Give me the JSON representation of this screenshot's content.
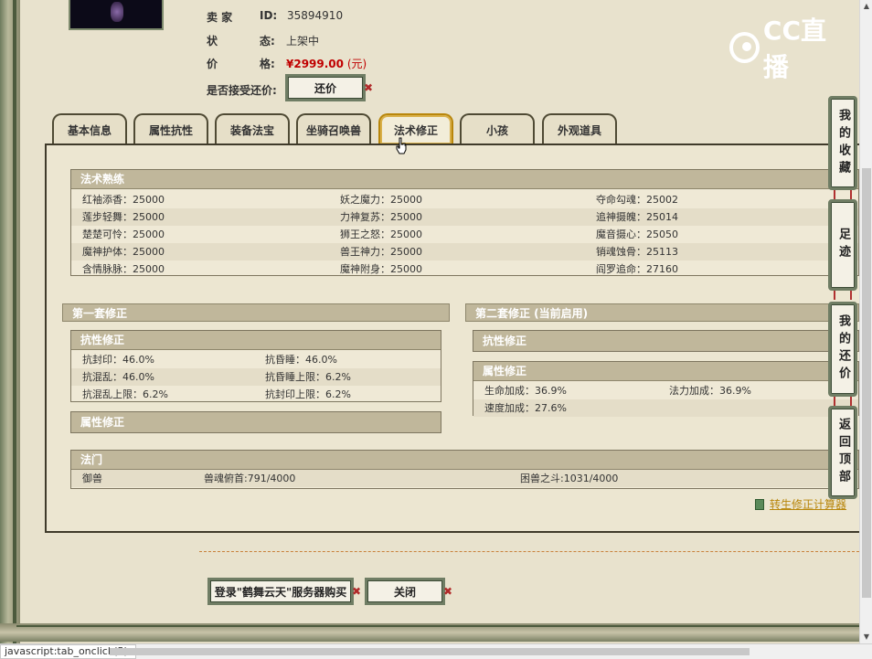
{
  "seller": {
    "seller_label": "卖 家",
    "id_label": "ID:",
    "id_value": "35894910",
    "status_label": "状",
    "status_label2": "态:",
    "status_value": "上架中",
    "price_label": "价",
    "price_label2": "格:",
    "price_value": "¥2999.00",
    "price_unit": "(元)",
    "bargain_label": "是否接受还价:",
    "bargain_button": "还价"
  },
  "logo": {
    "text": "CC直播"
  },
  "tabs": [
    {
      "label": "基本信息"
    },
    {
      "label": "属性抗性"
    },
    {
      "label": "装备法宝"
    },
    {
      "label": "坐骑召唤兽"
    },
    {
      "label": "法术修正"
    },
    {
      "label": "小孩"
    },
    {
      "label": "外观道具"
    }
  ],
  "spell_mastery": {
    "title": "法术熟练",
    "rows": [
      [
        "红袖添香：25000",
        "妖之魔力：25000",
        "夺命勾魂：25002"
      ],
      [
        "莲步轻舞：25000",
        "力神复苏：25000",
        "追神摄魄：25014"
      ],
      [
        "楚楚可怜：25000",
        "狮王之怒：25000",
        "魔音摄心：25050"
      ],
      [
        "魔神护体：25000",
        "兽王神力：25000",
        "销魂蚀骨：25113"
      ],
      [
        "含情脉脉：25000",
        "魔神附身：25000",
        "阎罗追命：27160"
      ]
    ]
  },
  "set1": {
    "title": "第一套修正",
    "resist_title": "抗性修正",
    "resist_rows": [
      [
        "抗封印：46.0%",
        "抗昏睡：46.0%"
      ],
      [
        "抗混乱：46.0%",
        "抗昏睡上限：6.2%"
      ],
      [
        "抗混乱上限：6.2%",
        "抗封印上限：6.2%"
      ]
    ],
    "attr_title": "属性修正"
  },
  "set2": {
    "title": "第二套修正 (当前启用)",
    "resist_title": "抗性修正",
    "attr_title": "属性修正",
    "attr_rows": [
      [
        "生命加成：36.9%",
        "法力加成：36.9%"
      ],
      [
        "速度加成：27.6%",
        ""
      ]
    ]
  },
  "fa_men": {
    "title": "法门",
    "rows": [
      [
        "御兽",
        "兽魂俯首:791/4000",
        "困兽之斗:1031/4000"
      ]
    ]
  },
  "calc_link": "转生修正计算器",
  "bottom_buttons": {
    "login_buy": "登录\"鹤舞云天\"服务器购买",
    "close": "关闭"
  },
  "side_buttons": [
    {
      "label": "我的收藏"
    },
    {
      "label": "足迹"
    },
    {
      "label": "我的还价"
    },
    {
      "label": "返回顶部"
    }
  ],
  "status_bar": "javascript:tab_onclick(5);",
  "colors": {
    "price": "#c00000",
    "section_head": "#c0b79b",
    "active_tab_border": "#b8860b",
    "link": "#b8860b"
  }
}
